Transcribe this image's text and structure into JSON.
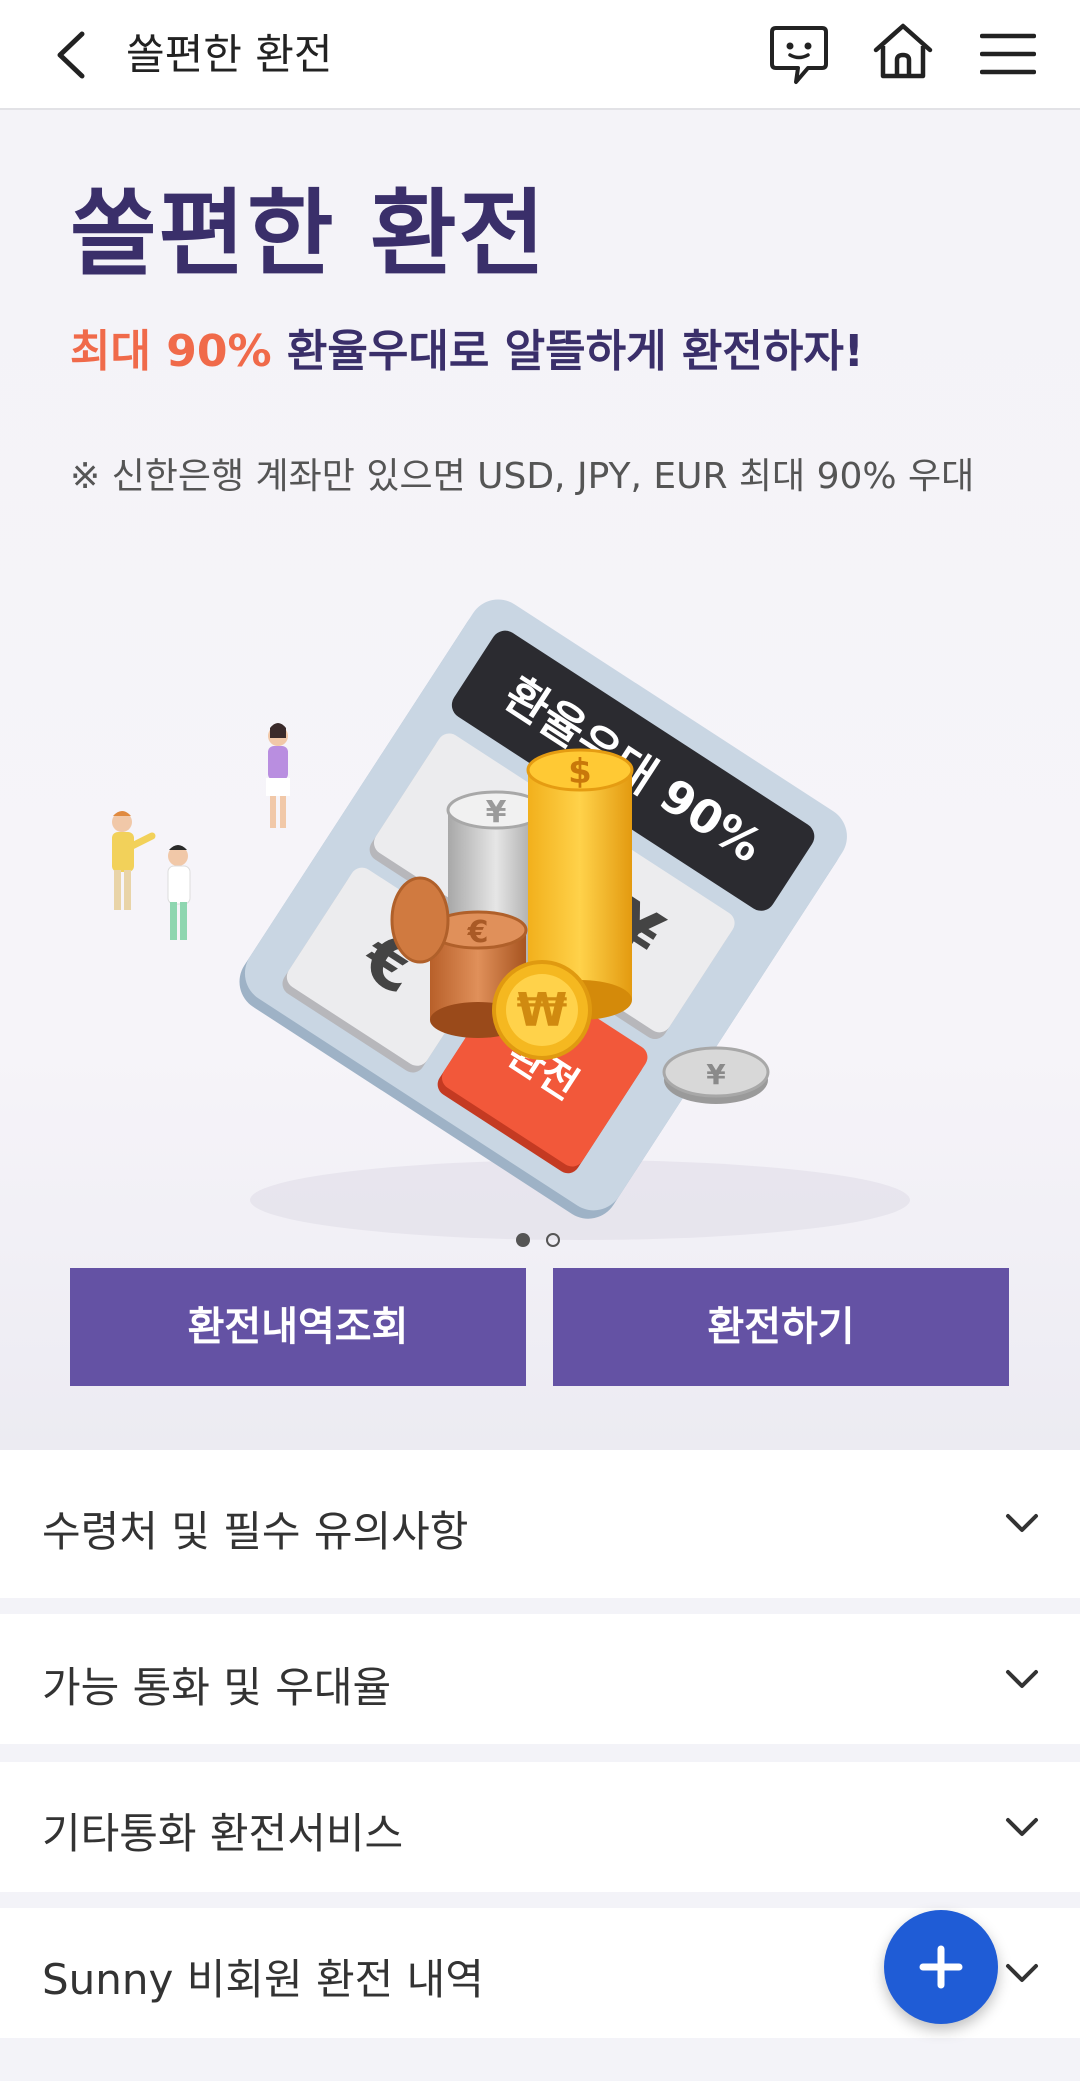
{
  "header": {
    "title": "쏠편한 환전",
    "back_icon": "back-arrow-icon",
    "chat_icon": "chat-bubble-icon",
    "home_icon": "home-icon",
    "menu_icon": "hamburger-menu-icon"
  },
  "hero": {
    "title": "쏠편한 환전",
    "subtitle_accent": "최대 90%",
    "subtitle_rest": " 환율우대로 알뜰하게 환전하자!",
    "note": "※ 신한은행 계좌만 있으면 USD, JPY, EUR 최대 90% 우대",
    "illustration": {
      "screen_text": "환율우대 90%",
      "key_exchange": "환전",
      "key_symbols": [
        "$",
        "€",
        "¥",
        "₩"
      ]
    },
    "carousel": {
      "current": 1,
      "total": 2
    }
  },
  "buttons": {
    "history": "환전내역조회",
    "exchange": "환전하기"
  },
  "accordion": [
    {
      "label": "수령처 및 필수 유의사항"
    },
    {
      "label": "가능 통화 및 우대율"
    },
    {
      "label": "기타통화 환전서비스"
    },
    {
      "label": "Sunny 비회원 환전 내역"
    }
  ],
  "colors": {
    "brand_purple": "#6452a4",
    "title_navy": "#3a2f6a",
    "accent_orange": "#f06a4a",
    "fab_blue": "#1f5cd6"
  },
  "fab": {
    "icon": "plus-icon"
  }
}
